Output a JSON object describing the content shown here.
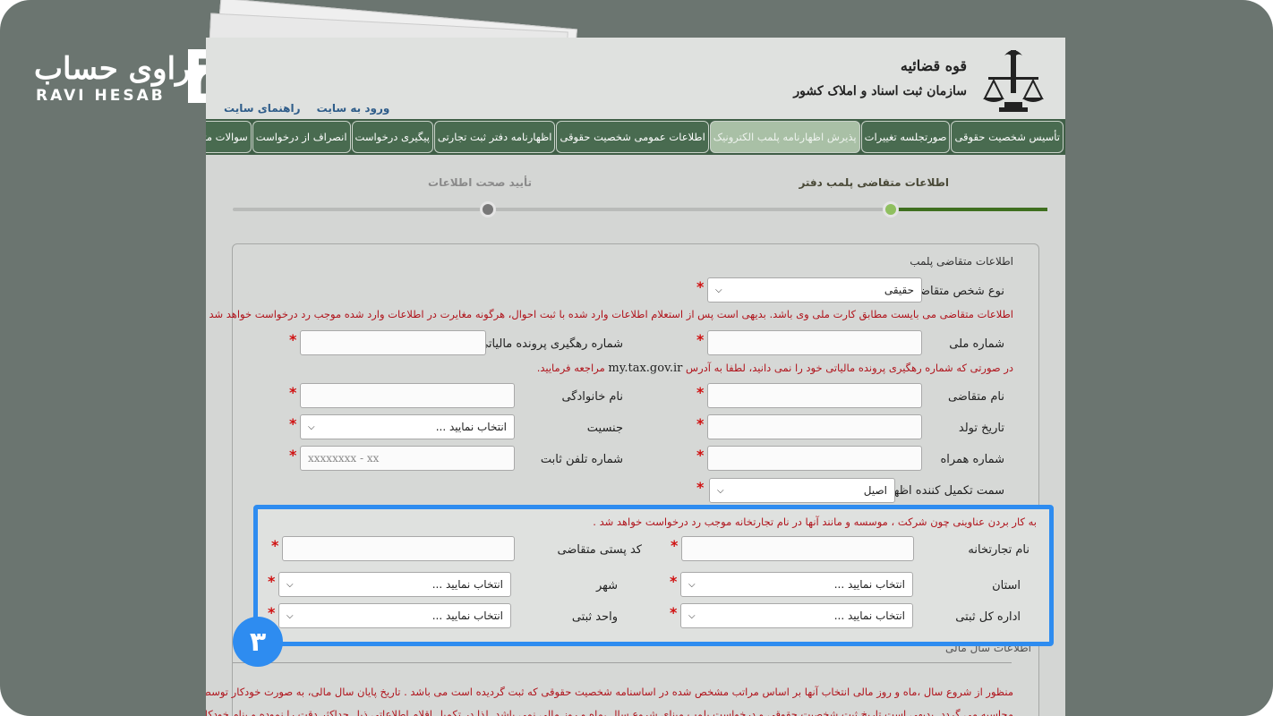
{
  "brand": {
    "name_fa": "راوی حساب",
    "name_en": "RAVI HESAB"
  },
  "header": {
    "org_line1": "قوه قضائیه",
    "org_line2": "سازمان ثبت اسناد و املاک کشور",
    "links": [
      "ورود به سایت",
      "راهنمای سایت"
    ]
  },
  "nav": {
    "tabs": [
      {
        "label": "تأسیس شخصیت حقوقی",
        "active": false
      },
      {
        "label": "صورتجلسه تغییرات",
        "active": false
      },
      {
        "label": "پذیرش اظهارنامه پلمب الکترونیک",
        "active": true
      },
      {
        "label": "اطلاعات عمومی شخصیت حقوقی",
        "active": false
      },
      {
        "label": "اظهارنامه دفتر ثبت تجارتی",
        "active": false
      },
      {
        "label": "پیگیری درخواست",
        "active": false
      },
      {
        "label": "انصراف از درخواست",
        "active": false
      },
      {
        "label": "سوالات متداول",
        "active": false
      }
    ]
  },
  "steps": {
    "step1": "اطلاعات متقاضی پلمب دفتر",
    "step2": "تأیید صحت اطلاعات"
  },
  "form": {
    "panel_title": "اطلاعات متقاضی پلمب",
    "applicant_type_label": "نوع شخص متقاضی",
    "applicant_type_value": "حقیقی",
    "warning1": "اطلاعات متقاضی می بایست مطابق کارت ملی وی باشد. بدیهی است پس از استعلام اطلاعات وارد شده با ثبت احوال، هرگونه مغایرت در اطلاعات وارد شده موجب رد درخواست خواهد شد",
    "national_id_label": "شماره ملی",
    "tax_tracking_label": "شماره رهگیری پرونده مالیاتی",
    "warning2_prefix": "در صورتی که شماره رهگیری پرونده مالیاتی خود را نمی دانید، لطفا به آدرس",
    "warning2_link": "my.tax.gov.ir",
    "warning2_suffix": "مراجعه فرمایید.",
    "first_name_label": "نام متقاضی",
    "last_name_label": "نام خانوادگی",
    "birth_date_label": "تاریخ تولد",
    "gender_label": "جنسیت",
    "gender_value": "انتخاب نمایید ...",
    "mobile_label": "شماره همراه",
    "landline_label": "شماره تلفن ثابت",
    "landline_placeholder": "xxxxxxxx - xx",
    "role_label": "سمت تکمیل کننده اظهارنامه",
    "role_value": "اصیل",
    "warning3": "به کار بردن عناوینی چون شرکت ، موسسه و مانند آنها در نام تجارتخانه موجب رد درخواست خواهد شد .",
    "trade_name_label": "نام تجارتخانه",
    "postal_code_label": "کد پستی متقاضی",
    "province_label": "استان",
    "province_value": "انتخاب نمایید ...",
    "city_label": "شهر",
    "city_value": "انتخاب نمایید ...",
    "general_office_label": "اداره کل ثبتی",
    "general_office_value": "انتخاب نمایید ...",
    "registry_unit_label": "واحد ثبتی",
    "registry_unit_value": "انتخاب نمایید ...",
    "section2_title": "اطلاعات سال مالی",
    "fiscal_note_line1": "منظور از شروع سال ،ماه و روز مالی انتخاب آنها بر اساس مراتب مشخص شده در اساسنامه شخصیت حقوقی که ثبت گردیده است می باشد . تاریخ پایان سال مالی، به صورت خودکار توسط سامانه",
    "fiscal_note_line2": "محاسبه می گردد. بدیهی است تاریخ ثبت شخصیت حقوقی و درخواست پلمب مبنای شروع سال ،ماه و روز مالی نمی باشد. لذا در تکمیل اقلام اطلاعاتی ذیل حداکثر دقت را نموده و بنام خودکار"
  },
  "step_badge": "۳"
}
